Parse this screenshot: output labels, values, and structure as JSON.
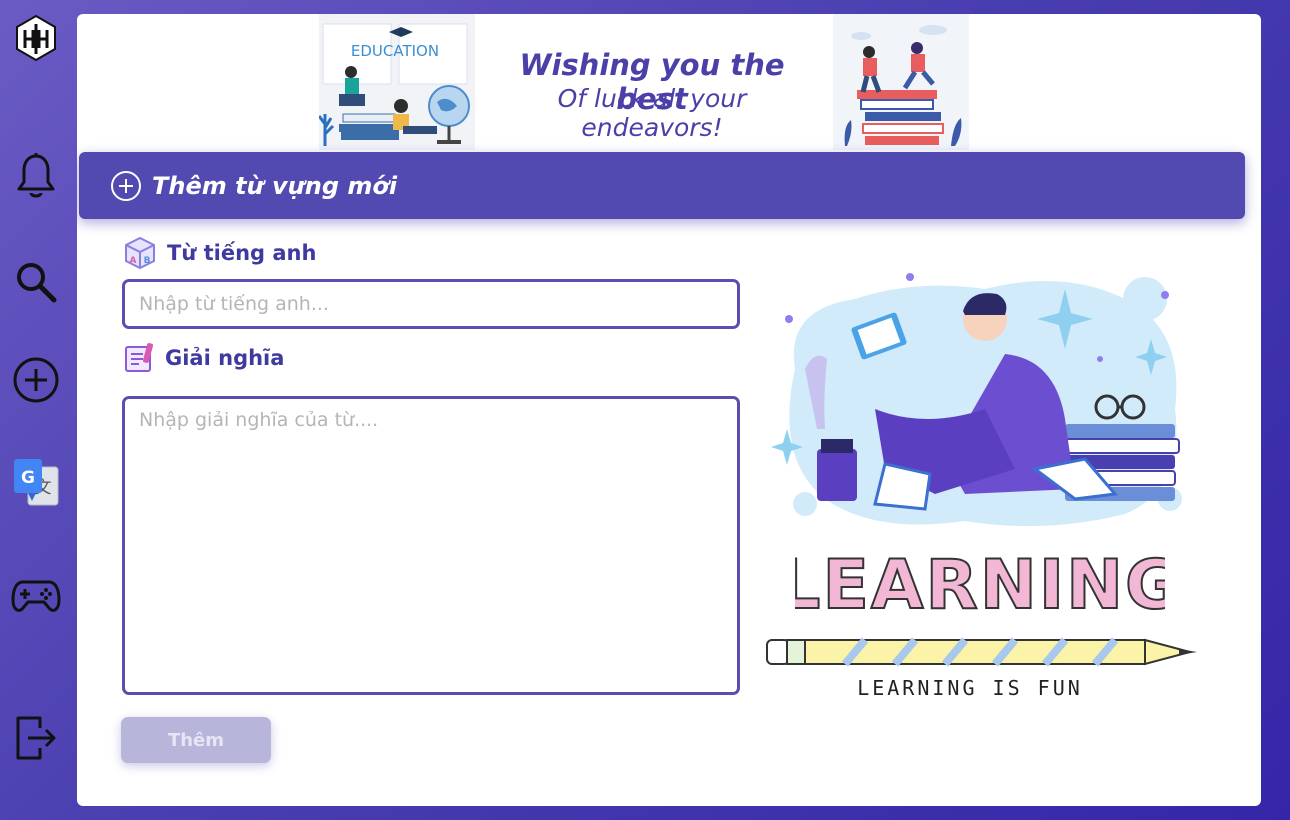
{
  "sidebar": {
    "logo": "app-logo",
    "items": [
      {
        "icon": "bell-icon"
      },
      {
        "icon": "search-icon"
      },
      {
        "icon": "add-circle-icon"
      },
      {
        "icon": "google-translate-icon"
      },
      {
        "icon": "gamepad-icon"
      },
      {
        "icon": "logout-icon"
      }
    ]
  },
  "banner": {
    "left_image_text": "EDUCATION",
    "line1": "Wishing you the best",
    "line2": "Of luck all your endeavors!"
  },
  "header": {
    "title": "Thêm từ vựng mới"
  },
  "form": {
    "word_label": "Từ tiếng anh",
    "word_placeholder": "Nhập từ tiếng anh...",
    "meaning_label": "Giải nghĩa",
    "meaning_placeholder": "Nhập giải nghĩa của từ....",
    "submit_label": "Thêm"
  },
  "illustration": {
    "big_text": "LEARNING",
    "caption": "LEARNING IS FUN"
  },
  "colors": {
    "accent": "#524ab0",
    "sidebar": "#5a4bb8",
    "button_disabled": "#b8b5da"
  }
}
